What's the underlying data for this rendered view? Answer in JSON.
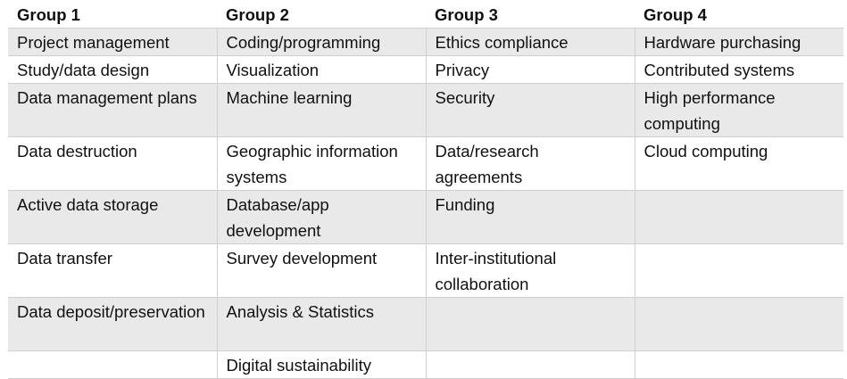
{
  "headers": [
    "Group 1",
    "Group 2",
    "Group 3",
    "Group 4"
  ],
  "rows": [
    [
      "Project management",
      "Coding/programming",
      "Ethics compliance",
      "Hardware purchasing"
    ],
    [
      "Study/data design",
      "Visualization",
      "Privacy",
      "Contributed systems"
    ],
    [
      "Data management plans",
      "Machine learning",
      "Security",
      "High performance computing"
    ],
    [
      "Data destruction",
      "Geographic information systems",
      "Data/research agreements",
      "Cloud computing"
    ],
    [
      "Active data storage",
      "Database/app development",
      "Funding",
      ""
    ],
    [
      "Data transfer",
      "Survey development",
      "Inter-institutional collaboration",
      ""
    ],
    [
      "Data deposit/preservation",
      "Analysis & Statistics",
      "",
      ""
    ],
    [
      "",
      "Digital sustainability",
      "",
      ""
    ]
  ]
}
